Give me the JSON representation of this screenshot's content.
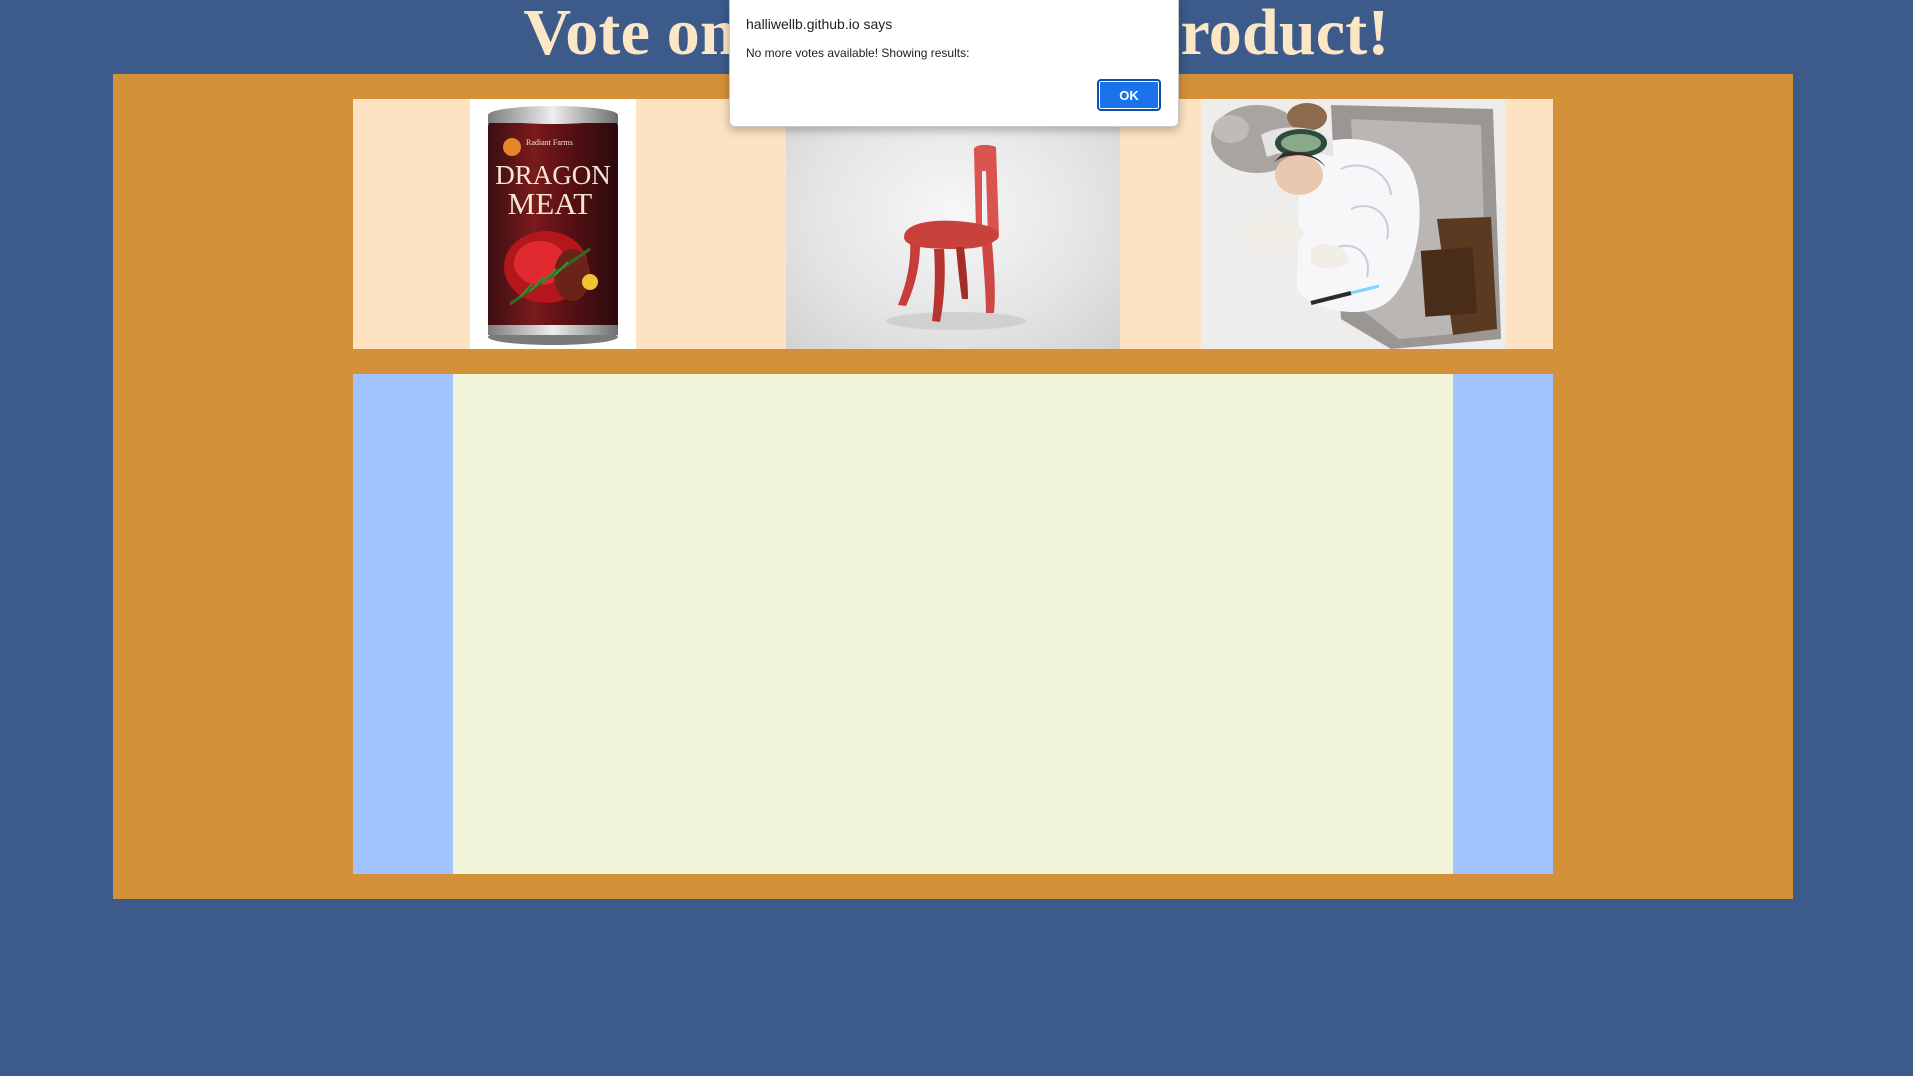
{
  "page": {
    "title": "Vote on Our Favorite product!",
    "background_color": "#3c5a8a",
    "panel_color": "#d49139",
    "strip_color": "#fde3c1",
    "results_side_color": "#a2c4ff",
    "results_canvas_color": "#f2f4da",
    "title_color": "#fbe6c5"
  },
  "products": [
    {
      "name": "dragon-meat-can",
      "label_brand": "Radiant Farms",
      "label_title_1": "DRAGON",
      "label_title_2": "MEAT"
    },
    {
      "name": "red-chair"
    },
    {
      "name": "tauntaun-sleeping-bag"
    }
  ],
  "alert": {
    "origin": "halliwellb.github.io says",
    "message": "No more votes available! Showing results:",
    "ok_label": "OK",
    "button_color": "#1a73e8"
  }
}
